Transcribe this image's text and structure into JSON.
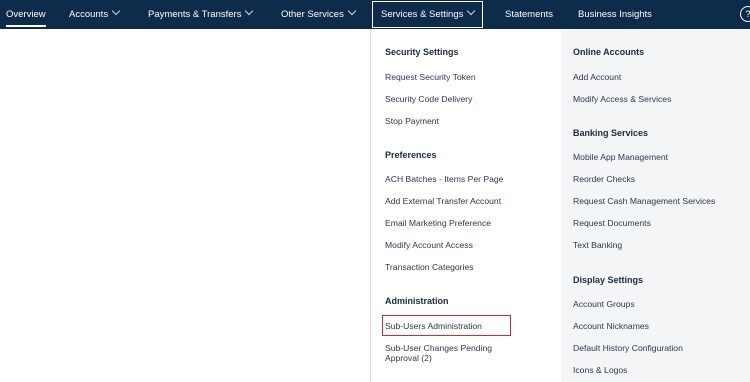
{
  "nav": {
    "items": [
      {
        "label": "Overview"
      },
      {
        "label": "Accounts"
      },
      {
        "label": "Payments & Transfers"
      },
      {
        "label": "Other Services"
      },
      {
        "label": "Services & Settings"
      },
      {
        "label": "Statements"
      },
      {
        "label": "Business Insights"
      }
    ],
    "help_icon": "?"
  },
  "menu": {
    "security": {
      "heading": "Security Settings",
      "links": [
        "Request Security Token",
        "Security Code Delivery",
        "Stop Payment"
      ]
    },
    "preferences": {
      "heading": "Preferences",
      "links": [
        "ACH Batches - Items Per Page",
        "Add External Transfer Account",
        "Email Marketing Preference",
        "Modify Account Access",
        "Transaction Categories"
      ]
    },
    "administration": {
      "heading": "Administration",
      "links": [
        "Sub-Users Administration",
        "Sub-User Changes Pending Approval (2)"
      ]
    },
    "online_accounts": {
      "heading": "Online Accounts",
      "links": [
        "Add Account",
        "Modify Access & Services"
      ]
    },
    "banking_services": {
      "heading": "Banking Services",
      "links": [
        "Mobile App Management",
        "Reorder Checks",
        "Request Cash Management Services",
        "Request Documents",
        "Text Banking"
      ]
    },
    "display_settings": {
      "heading": "Display Settings",
      "links": [
        "Account Groups",
        "Account Nicknames",
        "Default History Configuration",
        "Icons & Logos"
      ]
    }
  },
  "colors": {
    "navbar": "#0d2b4a",
    "highlight": "#d12b2b"
  }
}
